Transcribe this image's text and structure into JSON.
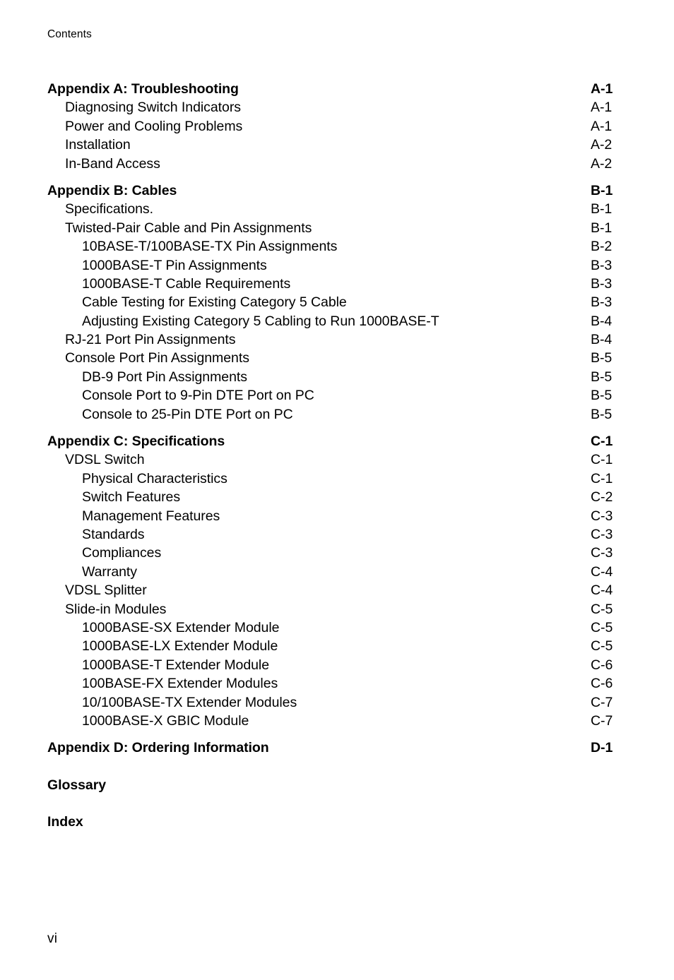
{
  "header": {
    "running_head": "Contents"
  },
  "footer": {
    "folio": "vi"
  },
  "toc": {
    "entries": [
      {
        "title": "Appendix A: Troubleshooting",
        "page": "A-1",
        "level": 0,
        "gap": "section"
      },
      {
        "title": "Diagnosing Switch Indicators",
        "page": "A-1",
        "level": 1,
        "gap": "none"
      },
      {
        "title": "Power and Cooling Problems",
        "page": "A-1",
        "level": 1,
        "gap": "none"
      },
      {
        "title": "Installation",
        "page": "A-2",
        "level": 1,
        "gap": "none"
      },
      {
        "title": "In-Band Access",
        "page": "A-2",
        "level": 1,
        "gap": "none"
      },
      {
        "title": "Appendix B: Cables",
        "page": "B-1",
        "level": 0,
        "gap": "section"
      },
      {
        "title": "Specifications.",
        "page": "B-1",
        "level": 1,
        "gap": "none"
      },
      {
        "title": "Twisted-Pair Cable and Pin Assignments",
        "page": "B-1",
        "level": 1,
        "gap": "none"
      },
      {
        "title": "10BASE-T/100BASE-TX Pin Assignments",
        "page": "B-2",
        "level": 2,
        "gap": "none"
      },
      {
        "title": "1000BASE-T Pin Assignments",
        "page": "B-3",
        "level": 2,
        "gap": "none"
      },
      {
        "title": "1000BASE-T Cable Requirements",
        "page": "B-3",
        "level": 2,
        "gap": "none"
      },
      {
        "title": "Cable Testing for Existing Category 5 Cable",
        "page": "B-3",
        "level": 2,
        "gap": "none"
      },
      {
        "title": "Adjusting Existing Category 5 Cabling to Run 1000BASE-T",
        "page": "B-4",
        "level": 2,
        "gap": "none"
      },
      {
        "title": "RJ-21 Port Pin Assignments",
        "page": "B-4",
        "level": 1,
        "gap": "none"
      },
      {
        "title": "Console Port Pin Assignments",
        "page": "B-5",
        "level": 1,
        "gap": "none"
      },
      {
        "title": "DB-9 Port Pin Assignments",
        "page": "B-5",
        "level": 2,
        "gap": "none"
      },
      {
        "title": "Console Port to 9-Pin DTE Port on PC",
        "page": "B-5",
        "level": 2,
        "gap": "none"
      },
      {
        "title": "Console to 25-Pin DTE Port on PC",
        "page": "B-5",
        "level": 2,
        "gap": "none"
      },
      {
        "title": "Appendix C: Specifications",
        "page": "C-1",
        "level": 0,
        "gap": "section"
      },
      {
        "title": "VDSL Switch",
        "page": "C-1",
        "level": 1,
        "gap": "none"
      },
      {
        "title": "Physical Characteristics",
        "page": "C-1",
        "level": 2,
        "gap": "none"
      },
      {
        "title": "Switch Features",
        "page": "C-2",
        "level": 2,
        "gap": "none"
      },
      {
        "title": "Management Features",
        "page": "C-3",
        "level": 2,
        "gap": "none"
      },
      {
        "title": "Standards",
        "page": "C-3",
        "level": 2,
        "gap": "none"
      },
      {
        "title": "Compliances",
        "page": "C-3",
        "level": 2,
        "gap": "none"
      },
      {
        "title": "Warranty",
        "page": "C-4",
        "level": 2,
        "gap": "none"
      },
      {
        "title": "VDSL Splitter",
        "page": "C-4",
        "level": 1,
        "gap": "none"
      },
      {
        "title": "Slide-in Modules",
        "page": "C-5",
        "level": 1,
        "gap": "none"
      },
      {
        "title": "1000BASE-SX Extender Module",
        "page": "C-5",
        "level": 2,
        "gap": "none"
      },
      {
        "title": "1000BASE-LX Extender Module",
        "page": "C-5",
        "level": 2,
        "gap": "none"
      },
      {
        "title": "1000BASE-T Extender Module",
        "page": "C-6",
        "level": 2,
        "gap": "none"
      },
      {
        "title": "100BASE-FX Extender Modules",
        "page": "C-6",
        "level": 2,
        "gap": "none"
      },
      {
        "title": "10/100BASE-TX Extender Modules",
        "page": "C-7",
        "level": 2,
        "gap": "none"
      },
      {
        "title": "1000BASE-X GBIC Module",
        "page": "C-7",
        "level": 2,
        "gap": "none"
      },
      {
        "title": "Appendix D: Ordering Information",
        "page": "D-1",
        "level": 0,
        "gap": "section"
      },
      {
        "title": "Glossary",
        "page": "",
        "level": 0,
        "gap": "back"
      },
      {
        "title": "Index",
        "page": "",
        "level": 0,
        "gap": "back"
      }
    ]
  }
}
